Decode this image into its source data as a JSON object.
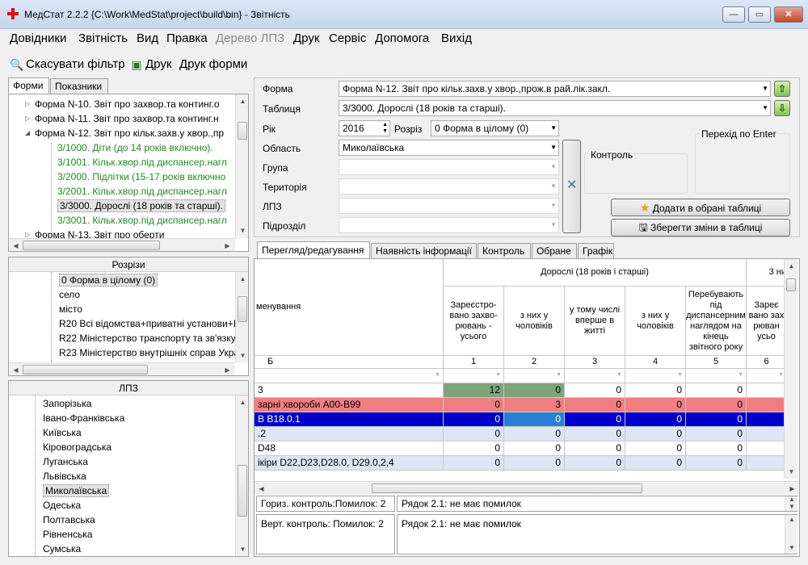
{
  "app": {
    "title": "МедСтат 2.2.2  {C:\\Work\\MedStat\\project\\build\\bin} - Звітність"
  },
  "window_buttons": {
    "minimize": "—",
    "maximize": "▭",
    "close": "✕"
  },
  "menu": [
    "Довідники",
    "Звітність",
    "Вид",
    "Правка",
    "Дерево ЛПЗ",
    "Друк",
    "Сервіс",
    "Допомога",
    "Вихід"
  ],
  "toolbar": {
    "cancel_filter": "Скасувати фільтр",
    "print": "Друк",
    "print_forms": "Друк форми"
  },
  "left_tabs": [
    "Форми",
    "Показники"
  ],
  "forms_tree": [
    {
      "label": "Форма N-10. Звіт про захвор.та континг.о",
      "expander": "▷",
      "cls": ""
    },
    {
      "label": "Форма N-11. Звіт про захвор.та континг.н",
      "expander": "▷",
      "cls": ""
    },
    {
      "label": "Форма N-12. Звіт про кільк.захв.у хвор.,пр",
      "expander": "◢",
      "cls": ""
    },
    {
      "label": "3/1000. Діти (до 14 років включно).",
      "expander": "",
      "cls": "green"
    },
    {
      "label": "3/1001. Кільк.хвор.під диспансер.нагл",
      "expander": "",
      "cls": "green"
    },
    {
      "label": "3/2000. Підлітки (15-17 років включно",
      "expander": "",
      "cls": "green"
    },
    {
      "label": "3/2001. Кільк.хвор.під диспансер.нагл",
      "expander": "",
      "cls": "green"
    },
    {
      "label": "3/3000. Дорослі (18 років та старші).",
      "expander": "",
      "cls": "sel"
    },
    {
      "label": "3/3001. Кільк.хвор.під диспансер.нагл",
      "expander": "",
      "cls": "green"
    },
    {
      "label": "Форма N-13. Звіт про оберти",
      "expander": "▷",
      "cls": ""
    }
  ],
  "rozrizy": {
    "header": "Розрізи",
    "items": [
      "0 Форма в цілому (0)",
      "село",
      "місто",
      "R20 Всі відомства+приватні установи+І",
      "R22 Міністерство транспорту та зв'язку",
      "R23 Міністерство внутрішніх справ Укра"
    ]
  },
  "lpz": {
    "header": "ЛПЗ",
    "items": [
      "Запорізька",
      "Івано-Франківська",
      "Київська",
      "Кіровоградська",
      "Луганська",
      "Львівська",
      "Миколаївська",
      "Одеська",
      "Полтавська",
      "Рівненська",
      "Сумська"
    ],
    "selected": "Миколаївська"
  },
  "form": {
    "forma_label": "Форма",
    "forma_value": "Форма N-12. Звіт про кільк.захв.у хвор.,прож.в рай.лік.закл.",
    "table_label": "Таблиця",
    "table_value": "3/3000. Дорослі (18 років та старші).",
    "year_label": "Рік",
    "year_value": "2016",
    "rozriz_label": "Розріз",
    "rozriz_value": "0 Форма в цілому (0)",
    "oblast_label": "Область",
    "oblast_value": "Миколаївська",
    "grupa_label": "Група",
    "terytoriya_label": "Територія",
    "lpz_label": "ЛПЗ",
    "pidrozdil_label": "Підрозділ",
    "kontrol_label": "Контроль",
    "perehid_label": "Перехід по Enter",
    "add_fav": "Додати в обрані таблиці",
    "save_changes": "Зберегти зміни в таблиці"
  },
  "data_tabs": [
    "Перегляд/редагування",
    "Наявність інформації",
    "Контроль",
    "Обране",
    "Графік"
  ],
  "grid": {
    "group_header": "Дорослі (18 років і старші)",
    "group_header2": "3 ни",
    "name_header": "менування",
    "cols": [
      "Зареєстро-вано захво-рювань - усього",
      "з них у чоловіків",
      "у тому числі вперше в житті",
      "з них у чоловіків",
      "Перебувають під диспансерним наглядом на кінець звітного року",
      "Зареє вано зах рюван усьо"
    ],
    "col_numbers": [
      "Б",
      "1",
      "2",
      "3",
      "4",
      "5",
      "6"
    ],
    "rows": [
      {
        "name": "3",
        "vals": [
          "12",
          "0",
          "0",
          "0",
          "0",
          ""
        ]
      },
      {
        "name": "зарні хвороби  A00-B99",
        "vals": [
          "0",
          "3",
          "0",
          "0",
          "0",
          ""
        ]
      },
      {
        "name": "В  B18.0.1",
        "vals": [
          "0",
          "0",
          "0",
          "0",
          "0",
          ""
        ]
      },
      {
        "name": ".2",
        "vals": [
          "0",
          "0",
          "0",
          "0",
          "0",
          ""
        ]
      },
      {
        "name": "D48",
        "vals": [
          "0",
          "0",
          "0",
          "0",
          "0",
          ""
        ]
      },
      {
        "name": "ікіри D22,D23,D28.0, D29.0,2,4",
        "vals": [
          "0",
          "0",
          "0",
          "0",
          "0",
          ""
        ]
      }
    ]
  },
  "controls": {
    "horiz_label": "Гориз. контроль:Помилок: 2",
    "horiz_msg": "Рядок 2.1: не має помилок",
    "vert_label": "Верт. контроль: Помилок: 2",
    "vert_msg": "Рядок 2.1: не має помилок"
  },
  "colors": {
    "green_row": "#7fa47a",
    "red_row": "#ef7f7f",
    "blue_row": "#0000c8",
    "light_row": "#dde5f7",
    "white_row": "#ffffff",
    "green_text": "#1f8a1f"
  }
}
